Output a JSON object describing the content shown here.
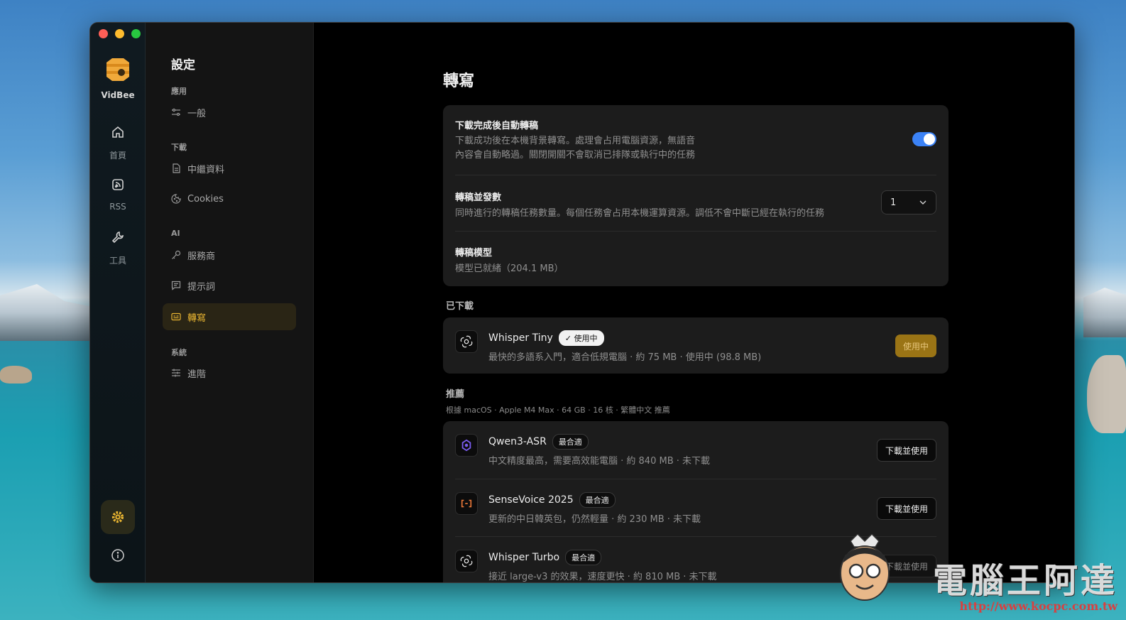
{
  "app": {
    "brand": "VidBee"
  },
  "rail": {
    "items": [
      {
        "label": "首頁",
        "icon": "home-icon"
      },
      {
        "label": "RSS",
        "icon": "rss-icon"
      },
      {
        "label": "工具",
        "icon": "wrench-icon"
      }
    ]
  },
  "sidebar": {
    "title": "設定",
    "sections": {
      "app": "應用",
      "download": "下載",
      "ai": "AI",
      "system": "系統"
    },
    "items": {
      "general": "一般",
      "metadata": "中繼資料",
      "cookies": "Cookies",
      "provider": "服務商",
      "prompt": "提示詞",
      "transcribe": "轉寫",
      "advanced": "進階"
    }
  },
  "main": {
    "title": "轉寫",
    "settings": {
      "auto": {
        "title": "下載完成後自動轉稿",
        "desc1": "下載成功後在本機背景轉寫。處理會占用電腦資源，無語音",
        "desc2": "內容會自動略過。關閉開關不會取消已排隊或執行中的任務",
        "enabled": true
      },
      "concurrency": {
        "title": "轉稿並發數",
        "desc": "同時進行的轉稿任務數量。每個任務會占用本機運算資源。調低不會中斷已經在執行的任務",
        "value": "1"
      },
      "model": {
        "title": "轉稿模型",
        "desc": "模型已就緒（204.1 MB）"
      }
    },
    "downloaded": {
      "label": "已下載",
      "models": [
        {
          "name": "Whisper Tiny",
          "badge": "✓ 使用中",
          "desc": "最快的多語系入門，適合低規電腦 · 約 75 MB · 使用中 (98.8 MB)",
          "action": "使用中"
        }
      ]
    },
    "recommended": {
      "label": "推薦",
      "sub": "根據 macOS · Apple M4 Max · 64 GB · 16 核 · 繁體中文 推薦",
      "models": [
        {
          "name": "Qwen3-ASR",
          "badge": "最合適",
          "desc": "中文精度最高，需要高效能電腦 · 約 840 MB · 未下載",
          "action": "下載並使用"
        },
        {
          "name": "SenseVoice 2025",
          "badge": "最合適",
          "desc": "更新的中日韓英包，仍然輕量 · 約 230 MB · 未下載",
          "action": "下載並使用"
        },
        {
          "name": "Whisper Turbo",
          "badge": "最合適",
          "desc": "接近 large-v3 的效果，速度更快 · 約 810 MB · 未下載",
          "action": "下載並使用"
        }
      ]
    }
  },
  "watermark": {
    "text": "電腦王阿達",
    "url": "http://www.kocpc.com.tw"
  },
  "colors": {
    "accent": "#e9b531",
    "toggle": "#3b82f6",
    "sidebar_active_bg": "#2a2515"
  }
}
